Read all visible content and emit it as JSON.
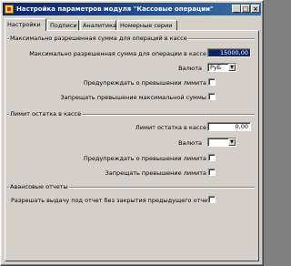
{
  "window": {
    "title": "Настройка параметров модуля \"Кассовые операции\"",
    "buttons": {
      "minimize": "_",
      "maximize": "□",
      "close": "×"
    }
  },
  "tabs": [
    {
      "label": "Настройки",
      "active": true
    },
    {
      "label": "Подписи",
      "active": false
    },
    {
      "label": "Аналитика",
      "active": false
    },
    {
      "label": "Номерные серии",
      "active": false
    }
  ],
  "group_max_sum": {
    "title": "Максимально разрешенная сумма для операций в кассе",
    "max_sum_label": "Максимально разрешенная сумма для операции в кассе",
    "max_sum_value": "15000,00",
    "currency_label": "Валюта",
    "currency_value": "РуБ",
    "warn_label": "Предупреждать о превышении лимита",
    "forbid_label": "Запрещать превышение максимальной суммы"
  },
  "group_balance_limit": {
    "title": "Лимит остатка в кассе",
    "limit_label": "Лимит остатка в кассе",
    "limit_value": "0,00",
    "currency_label": "Валюта",
    "currency_value": "",
    "warn_label": "Предупреждать о превышении лимита",
    "forbid_label": "Запрещать превышение лимита"
  },
  "group_reports": {
    "title": "Авансовые отчеты",
    "allow_label": "Разрешать выдачу под отчет без закрытия предыдущего отчета"
  }
}
